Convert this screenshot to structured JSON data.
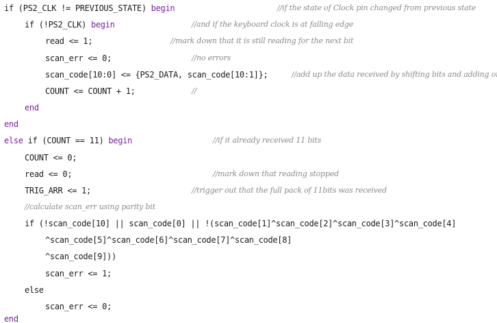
{
  "keyword_color": "#7a1ea1",
  "comment_color": "#8a8a8a",
  "lines": [
    {
      "pre": "if (PS2_CLK != PREVIOUS_STATE) ",
      "kw": "begin",
      "post": "",
      "comment": "//if the state of Clock pin changed from previous state"
    },
    {
      "pre": "if (!PS2_CLK) ",
      "kw": "begin",
      "post": "",
      "comment": "//and if the keyboard clock is at falling edge"
    },
    {
      "pre": "read <= 1;",
      "kw": "",
      "post": "",
      "comment": "//mark down that it is still reading for the next bit"
    },
    {
      "pre": "scan_err <= 0;",
      "kw": "",
      "post": "",
      "comment": "//no errors"
    },
    {
      "pre": "scan_code[10:0] <= {PS2_DATA, scan_code[10:1]};",
      "kw": "",
      "post": "",
      "comment": "//add up the data received by shifting bits and adding one new bit"
    },
    {
      "pre": "COUNT <= COUNT + 1;",
      "kw": "",
      "post": "",
      "comment": "//"
    },
    {
      "pre": "",
      "kw": "end",
      "post": "",
      "comment": ""
    },
    {
      "pre": "",
      "kw": "end",
      "post": "",
      "comment": ""
    },
    {
      "pre": "",
      "kw": "else",
      "post": " if (COUNT == 11) ",
      "kw2": "begin",
      "comment": "//if it already received 11 bits"
    },
    {
      "pre": "COUNT <= 0;",
      "kw": "",
      "post": "",
      "comment": ""
    },
    {
      "pre": "read <= 0;",
      "kw": "",
      "post": "",
      "comment": "//mark down that reading stopped"
    },
    {
      "pre": "TRIG_ARR <= 1;",
      "kw": "",
      "post": "",
      "comment": "//trigger out that the full pack of 11bits was received"
    },
    {
      "pre": "",
      "kw": "",
      "post": "",
      "comment": "//calculate scan_err using parity bit"
    },
    {
      "pre": "if (!scan_code[10] || scan_code[0] || !(scan_code[1]^scan_code[2]^scan_code[3]^scan_code[4]",
      "kw": "",
      "post": "",
      "comment": ""
    },
    {
      "pre": "^scan_code[5]^scan_code[6]^scan_code[7]^scan_code[8]",
      "kw": "",
      "post": "",
      "comment": ""
    },
    {
      "pre": "^scan_code[9]))",
      "kw": "",
      "post": "",
      "comment": ""
    },
    {
      "pre": "scan_err <= 1;",
      "kw": "",
      "post": "",
      "comment": ""
    },
    {
      "pre": "else",
      "kw": "",
      "post": "",
      "comment": ""
    },
    {
      "pre": "scan_err <= 0;",
      "kw": "",
      "post": "",
      "comment": ""
    },
    {
      "pre": "",
      "kw": "end",
      "post": "",
      "comment": ""
    }
  ]
}
